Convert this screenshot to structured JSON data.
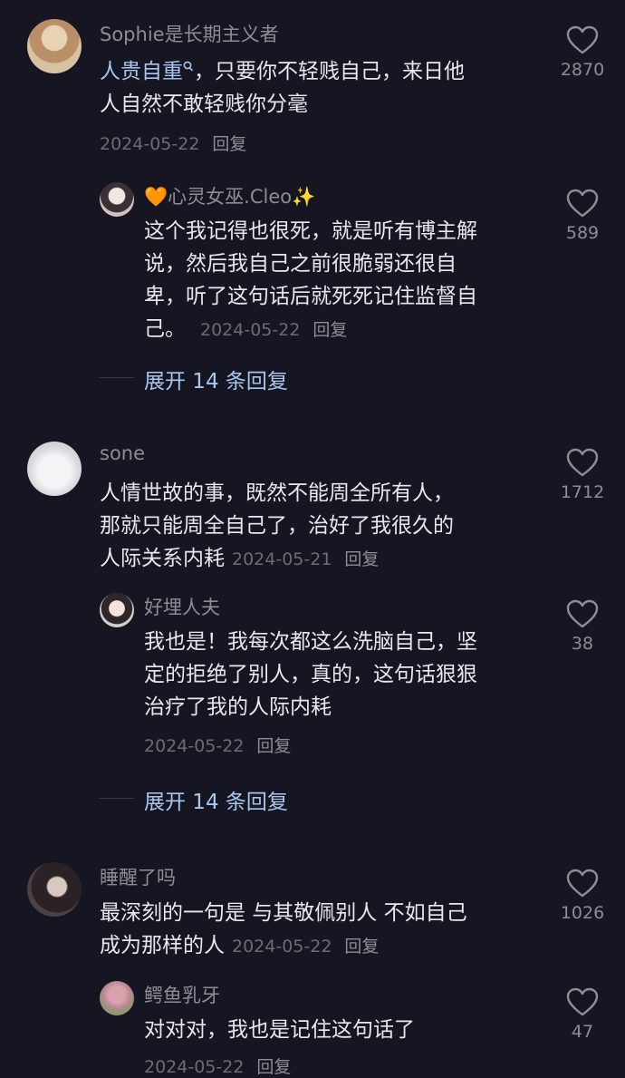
{
  "comments": [
    {
      "username": "Sophie是长期主义者",
      "text_keyword": "人贵自重",
      "keyword_icon": "search-icon",
      "text_line1": "，只要你不轻贱自己，来日他",
      "text_line2": "人自然不敢轻贱你分毫",
      "date": "2024-05-22",
      "reply": "回复",
      "likes": "2870",
      "replies": [
        {
          "username": "🧡心灵女巫.Cleo✨",
          "lines": [
            "这个我记得也很死，就是听有博主解",
            "说，然后我自己之前很脆弱还很自",
            "卑，听了这句话后就死死记住监督自"
          ],
          "last": "己。",
          "date": "2024-05-22",
          "reply": "回复",
          "likes": "589"
        }
      ],
      "expand": "展开 14 条回复"
    },
    {
      "username": "sone",
      "lines": [
        "人情世故的事，既然不能周全所有人，",
        "那就只能周全自己了，治好了我很久的"
      ],
      "last": "人际关系内耗",
      "date": "2024-05-21",
      "reply": "回复",
      "likes": "1712",
      "replies": [
        {
          "username": "好埋人夫",
          "lines": [
            "我也是！我每次都这么洗脑自己，坚",
            "定的拒绝了别人，真的，这句话狠狠",
            "治疗了我的人际内耗"
          ],
          "date": "2024-05-22",
          "reply": "回复",
          "likes": "38"
        }
      ],
      "expand": "展开 14 条回复"
    },
    {
      "username": "睡醒了吗",
      "lines": [
        "最深刻的一句是 与其敬佩别人 不如自己"
      ],
      "last": "成为那样的人",
      "date": "2024-05-22",
      "reply": "回复",
      "likes": "1026",
      "replies": [
        {
          "username": "鳄鱼乳牙",
          "lines": [
            "对对对，我也是记住这句话了"
          ],
          "date": "2024-05-22",
          "reply": "回复",
          "likes": "47"
        }
      ]
    }
  ],
  "colors": {
    "background": "#161622",
    "text": "#e8e8ec",
    "muted": "#8d8d96",
    "link": "#a9c6ee"
  }
}
